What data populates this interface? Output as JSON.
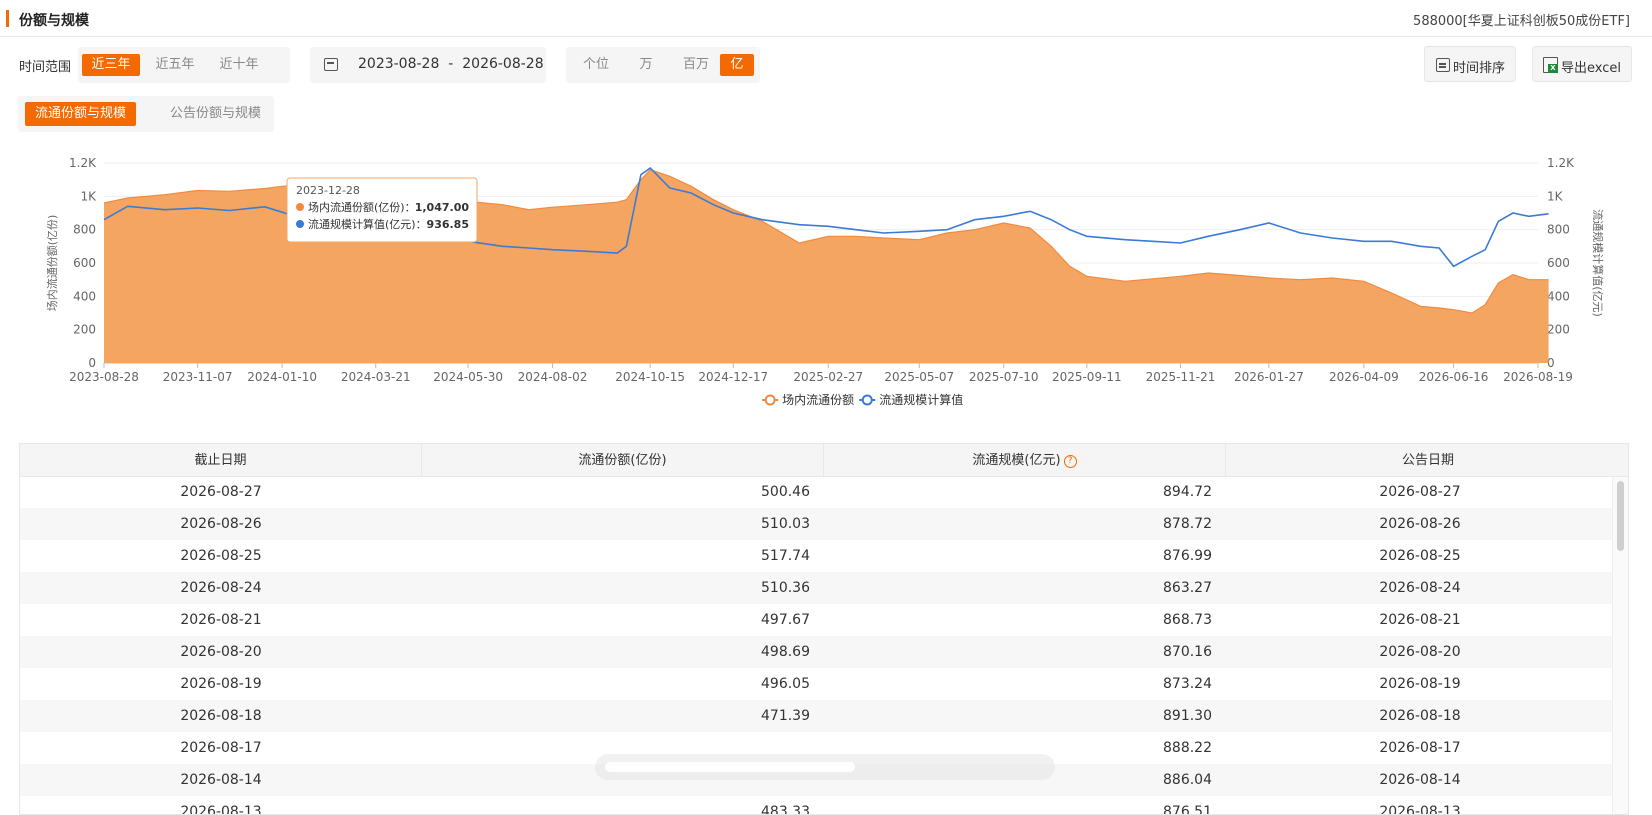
{
  "header": {
    "title": "份额与规模",
    "fund": "588000[华夏上证科创板50成份ETF]"
  },
  "toolbar": {
    "range_label": "时间范围",
    "ranges": [
      "近三年",
      "近五年",
      "近十年"
    ],
    "active_range": 0,
    "date_from": "2023-08-28",
    "date_sep": "-",
    "date_to": "2026-08-28",
    "units": [
      "个位",
      "万",
      "百万",
      "亿"
    ],
    "active_unit": 3,
    "sort_label": "时间排序",
    "export_label": "导出excel"
  },
  "subtabs": {
    "items": [
      "流通份额与规模",
      "公告份额与规模"
    ],
    "active": 0
  },
  "chart_data": {
    "type": "area",
    "x_ticks": [
      "2023-08-28",
      "2023-11-07",
      "2024-01-10",
      "2024-03-21",
      "2024-05-30",
      "2024-08-02",
      "2024-10-15",
      "2024-12-17",
      "2025-02-27",
      "2025-05-07",
      "2025-07-10",
      "2025-09-11",
      "2025-11-21",
      "2026-01-27",
      "2026-04-09",
      "2026-06-16",
      "2026-08-19"
    ],
    "y_ticks": [
      "0",
      "200",
      "400",
      "600",
      "800",
      "1K",
      "1.2K"
    ],
    "ylabel_left": "场内流通份额(亿份)",
    "ylabel_right": "流通规模计算值(亿元)",
    "ylim": [
      0,
      1200
    ],
    "x": [
      "2023-08-28",
      "2023-09-15",
      "2023-10-13",
      "2023-11-07",
      "2023-12-01",
      "2023-12-28",
      "2024-01-10",
      "2024-02-05",
      "2024-03-01",
      "2024-03-21",
      "2024-04-15",
      "2024-05-10",
      "2024-05-30",
      "2024-06-25",
      "2024-07-15",
      "2024-08-02",
      "2024-08-28",
      "2024-09-20",
      "2024-09-27",
      "2024-10-08",
      "2024-10-15",
      "2024-10-30",
      "2024-11-15",
      "2024-12-02",
      "2024-12-17",
      "2025-01-08",
      "2025-02-05",
      "2025-02-27",
      "2025-03-20",
      "2025-04-10",
      "2025-05-07",
      "2025-05-28",
      "2025-06-18",
      "2025-07-10",
      "2025-07-30",
      "2025-08-15",
      "2025-08-29",
      "2025-09-11",
      "2025-10-10",
      "2025-10-31",
      "2025-11-21",
      "2025-12-12",
      "2026-01-05",
      "2026-01-27",
      "2026-02-20",
      "2026-03-16",
      "2026-04-09",
      "2026-04-30",
      "2026-05-22",
      "2026-06-05",
      "2026-06-16",
      "2026-06-30",
      "2026-07-10",
      "2026-07-20",
      "2026-07-31",
      "2026-08-12",
      "2026-08-27"
    ],
    "series": [
      {
        "name": "场内流通份额",
        "color": "#f5a562",
        "values": [
          960,
          990,
          1010,
          1035,
          1030,
          1047,
          1060,
          1075,
          1060,
          1010,
          960,
          945,
          970,
          950,
          920,
          935,
          950,
          965,
          980,
          1100,
          1160,
          1120,
          1060,
          980,
          920,
          850,
          720,
          760,
          760,
          750,
          740,
          780,
          800,
          840,
          810,
          700,
          580,
          520,
          490,
          505,
          520,
          540,
          525,
          510,
          500,
          510,
          490,
          420,
          340,
          330,
          320,
          300,
          350,
          480,
          530,
          500,
          500
        ]
      },
      {
        "name": "流通规模计算值",
        "color": "#3a7bd5",
        "values": [
          860,
          940,
          920,
          930,
          915,
          937,
          905,
          840,
          820,
          770,
          750,
          740,
          730,
          700,
          690,
          680,
          670,
          660,
          700,
          1130,
          1170,
          1050,
          1020,
          950,
          900,
          860,
          830,
          820,
          800,
          780,
          790,
          800,
          860,
          880,
          910,
          860,
          800,
          760,
          740,
          730,
          720,
          760,
          800,
          840,
          780,
          750,
          730,
          730,
          700,
          690,
          580,
          640,
          680,
          850,
          900,
          880,
          895
        ]
      }
    ],
    "tooltip": {
      "date": "2023-12-28",
      "label1": "场内流通份额(亿份)：",
      "value1": "1,047.00",
      "label2": "流通规模计算值(亿元)：",
      "value2": "936.85"
    },
    "legend": [
      "场内流通份额",
      "流通规模计算值"
    ],
    "legend_position": "bottom"
  },
  "table": {
    "columns": [
      "截止日期",
      "流通份额(亿份)",
      "流通规模(亿元)",
      "公告日期"
    ],
    "help_icon": "?",
    "rows": [
      [
        "2026-08-27",
        "500.46",
        "894.72",
        "2026-08-27"
      ],
      [
        "2026-08-26",
        "510.03",
        "878.72",
        "2026-08-26"
      ],
      [
        "2026-08-25",
        "517.74",
        "876.99",
        "2026-08-25"
      ],
      [
        "2026-08-24",
        "510.36",
        "863.27",
        "2026-08-24"
      ],
      [
        "2026-08-21",
        "497.67",
        "868.73",
        "2026-08-21"
      ],
      [
        "2026-08-20",
        "498.69",
        "870.16",
        "2026-08-20"
      ],
      [
        "2026-08-19",
        "496.05",
        "873.24",
        "2026-08-19"
      ],
      [
        "2026-08-18",
        "471.39",
        "891.30",
        "2026-08-18"
      ],
      [
        "2026-08-17",
        "",
        "888.22",
        "2026-08-17"
      ],
      [
        "2026-08-14",
        "",
        "886.04",
        "2026-08-14"
      ],
      [
        "2026-08-13",
        "483.33",
        "876.51",
        "2026-08-13"
      ]
    ]
  }
}
